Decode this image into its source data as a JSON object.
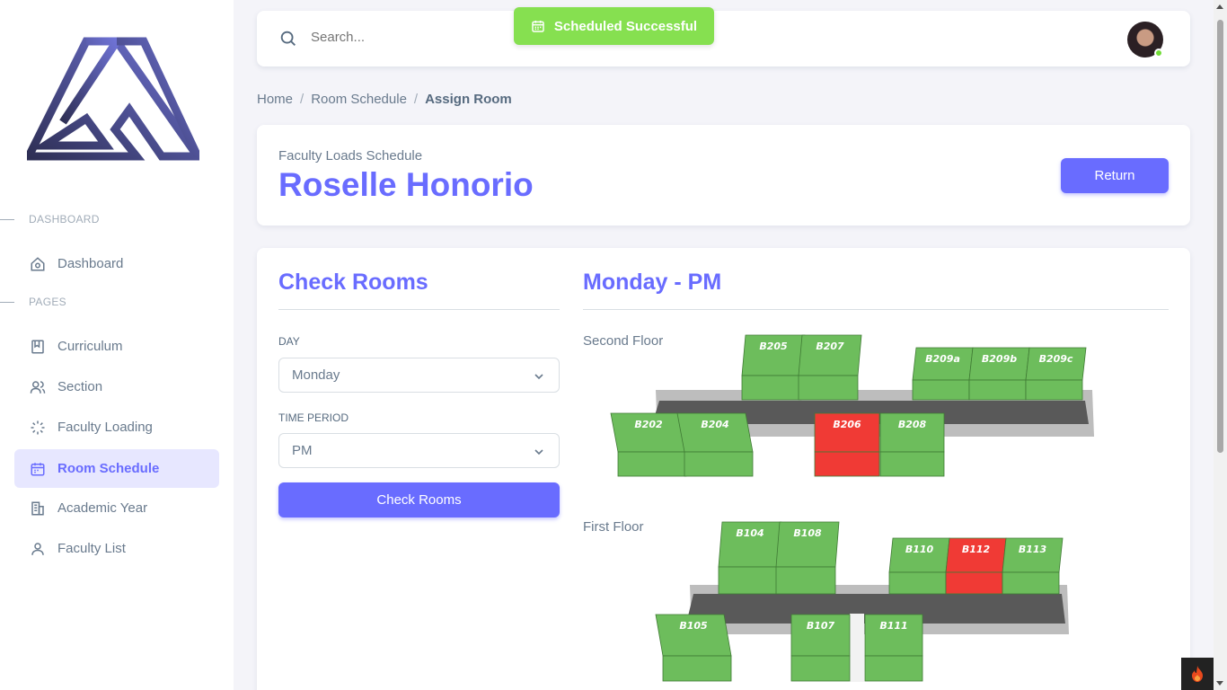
{
  "sidebar": {
    "sections": [
      {
        "label": "DASHBOARD"
      },
      {
        "label": "PAGES"
      }
    ],
    "items": [
      {
        "label": "Dashboard",
        "icon": "home-icon"
      },
      {
        "label": "Curriculum",
        "icon": "book-icon"
      },
      {
        "label": "Section",
        "icon": "users-icon"
      },
      {
        "label": "Faculty Loading",
        "icon": "loader-icon"
      },
      {
        "label": "Room Schedule",
        "icon": "calendar-icon"
      },
      {
        "label": "Academic Year",
        "icon": "building-icon"
      },
      {
        "label": "Faculty List",
        "icon": "user-icon"
      }
    ],
    "active_item": "Room Schedule"
  },
  "navbar": {
    "search_placeholder": "Search..."
  },
  "toast": {
    "message": "Scheduled Successful",
    "color": "#86e050"
  },
  "breadcrumb": {
    "items": [
      "Home",
      "Room Schedule",
      "Assign Room"
    ]
  },
  "header_card": {
    "subtitle": "Faculty Loads Schedule",
    "name": "Roselle Honorio",
    "return_label": "Return"
  },
  "check_rooms": {
    "title": "Check Rooms",
    "day_label": "DAY",
    "day_value": "Monday",
    "time_label": "TIME PERIOD",
    "time_value": "PM",
    "button_label": "Check Rooms"
  },
  "schedule": {
    "title": "Monday - PM",
    "second_floor": {
      "label": "Second Floor",
      "rooms": [
        {
          "id": "B205",
          "status": "available"
        },
        {
          "id": "B207",
          "status": "available"
        },
        {
          "id": "B209a",
          "status": "available"
        },
        {
          "id": "B209b",
          "status": "available"
        },
        {
          "id": "B209c",
          "status": "available"
        },
        {
          "id": "B202",
          "status": "available"
        },
        {
          "id": "B204",
          "status": "available"
        },
        {
          "id": "B206",
          "status": "occupied"
        },
        {
          "id": "B208",
          "status": "available"
        }
      ]
    },
    "first_floor": {
      "label": "First Floor",
      "rooms": [
        {
          "id": "B104",
          "status": "available"
        },
        {
          "id": "B108",
          "status": "available"
        },
        {
          "id": "B110",
          "status": "available"
        },
        {
          "id": "B112",
          "status": "occupied"
        },
        {
          "id": "B113",
          "status": "available"
        },
        {
          "id": "B105",
          "status": "available"
        },
        {
          "id": "B107",
          "status": "available"
        },
        {
          "id": "B111",
          "status": "available"
        }
      ]
    }
  },
  "colors": {
    "accent": "#696cff",
    "available": "#6dbd5c",
    "occupied": "#f03a35",
    "corridor": "#595959"
  }
}
